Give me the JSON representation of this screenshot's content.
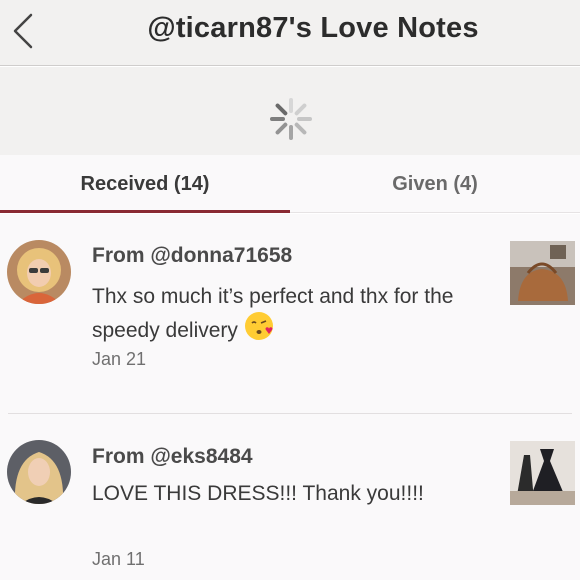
{
  "header": {
    "title": "@ticarn87's Love Notes"
  },
  "tabs": [
    {
      "label": "Received (14)",
      "active": true
    },
    {
      "label": "Given (4)",
      "active": false
    }
  ],
  "notes": [
    {
      "from": "From @donna71658",
      "message": "Thx so much it’s perfect and thx for the speedy delivery",
      "emoji": "kissing-face-emoji",
      "date": "Jan 21"
    },
    {
      "from": "From @eks8484",
      "message": "LOVE THIS DRESS!!!   Thank you!!!!",
      "date": "Jan 11"
    }
  ],
  "colors": {
    "accent": "#8a2a33",
    "header_bg": "#f2f1f0"
  }
}
